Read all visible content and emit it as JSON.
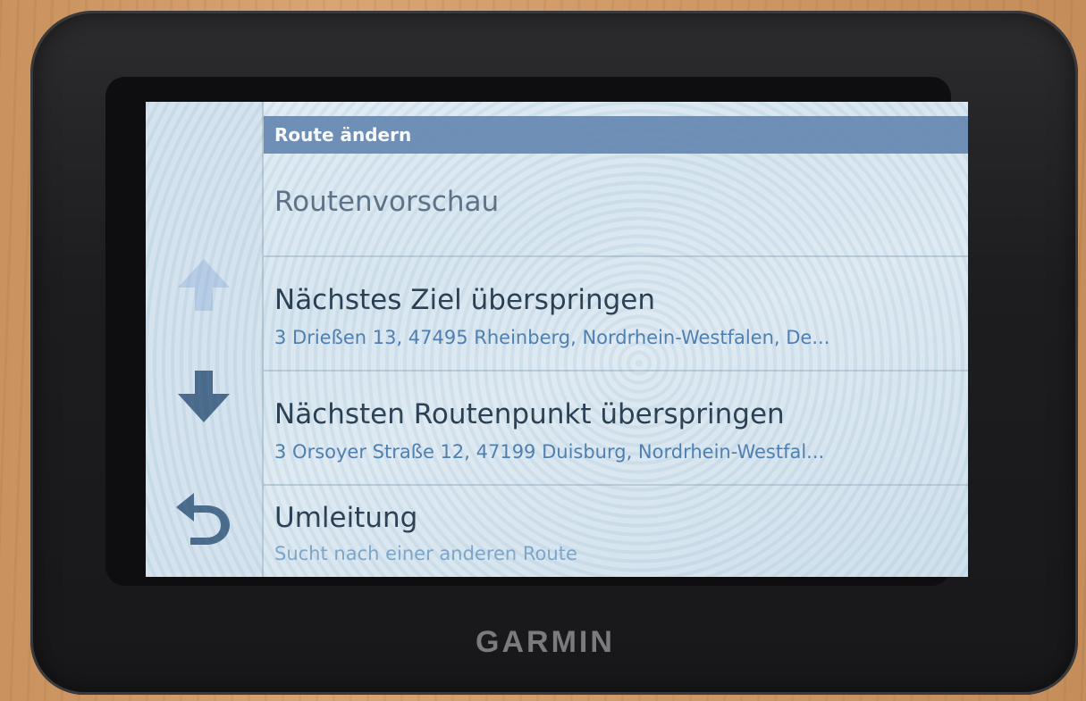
{
  "device": {
    "brand": "GARMIN"
  },
  "header": {
    "title": "Route ändern"
  },
  "side_buttons": [
    {
      "icon": "arrow-up-icon"
    },
    {
      "icon": "arrow-down-icon"
    },
    {
      "icon": "back-icon"
    }
  ],
  "menu": {
    "items": [
      {
        "title": "Routenvorschau"
      },
      {
        "title": "Nächstes Ziel überspringen",
        "subtitle": "3 Drießen 13, 47495 Rheinberg, Nordrhein-Westfalen, De..."
      },
      {
        "title": "Nächsten Routenpunkt überspringen",
        "subtitle": "3 Orsoyer Straße 12, 47199 Duisburg, Nordrhein-Westfal..."
      },
      {
        "title": "Umleitung",
        "subtitle": "Sucht nach einer anderen Route"
      }
    ]
  },
  "colors": {
    "header_bg": "#6f8fb7",
    "subtitle_text": "#4f7fb0",
    "icon_color": "#4a6a8c"
  }
}
